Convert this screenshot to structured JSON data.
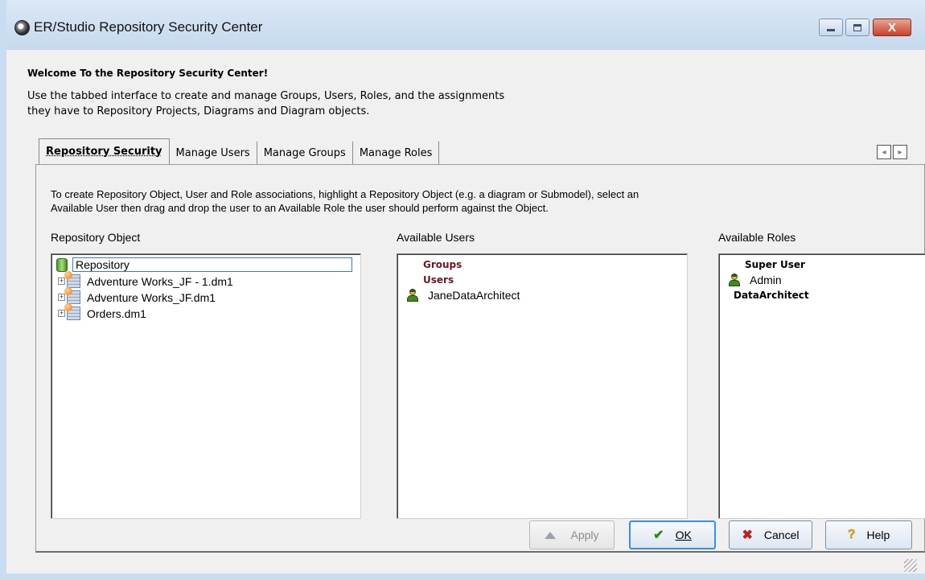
{
  "window": {
    "title": "ER/Studio Repository Security Center",
    "close_glyph": "X"
  },
  "header": {
    "welcome": "Welcome To the Repository Security Center!",
    "intro_line1": "Use the tabbed interface to create and manage Groups, Users, Roles, and the assignments",
    "intro_line2": "they have to Repository Projects, Diagrams and Diagram objects."
  },
  "tabs": [
    {
      "label": "Repository Security",
      "active": true
    },
    {
      "label": "Manage Users",
      "active": false
    },
    {
      "label": "Manage Groups",
      "active": false
    },
    {
      "label": "Manage Roles",
      "active": false
    }
  ],
  "panel": {
    "instructions_line1": "To create Repository Object, User and Role associations, highlight a Repository Object (e.g. a diagram or Submodel), select an",
    "instructions_line2": "Available User then drag and drop the user to an Available Role the user should perform against the Object."
  },
  "repository_object": {
    "label": "Repository Object",
    "root": "Repository",
    "items": [
      {
        "label": "Adventure Works_JF - 1.dm1",
        "expander": "+"
      },
      {
        "label": "Adventure Works_JF.dm1",
        "expander": "+"
      },
      {
        "label": "Orders.dm1",
        "expander": "+"
      }
    ]
  },
  "available_users": {
    "label": "Available Users",
    "groups_heading": "Groups",
    "users_heading": "Users",
    "users": [
      "JaneDataArchitect"
    ]
  },
  "available_roles": {
    "label": "Available Roles",
    "roles": [
      {
        "name": "Super User",
        "members": [
          "Admin"
        ]
      },
      {
        "name": "DataArchitect",
        "members": []
      }
    ]
  },
  "buttons": {
    "apply": "Apply",
    "ok": "OK",
    "cancel": "Cancel",
    "help": "Help",
    "ok_icon": "✔",
    "cancel_icon": "✖",
    "help_icon": "?"
  },
  "colors": {
    "group_heading": "#6a1822",
    "accent_focus": "#3a8ee6"
  }
}
